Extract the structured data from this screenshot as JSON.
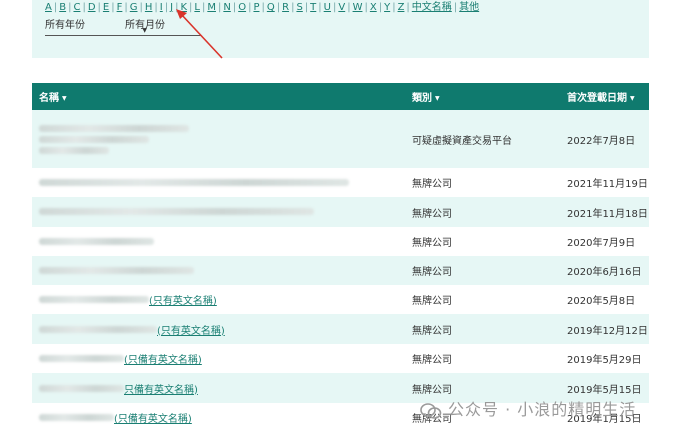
{
  "filters": {
    "letters": [
      "A",
      "B",
      "C",
      "D",
      "E",
      "F",
      "G",
      "H",
      "I",
      "J",
      "K",
      "L",
      "M",
      "N",
      "O",
      "P",
      "Q",
      "R",
      "S",
      "T",
      "U",
      "V",
      "W",
      "X",
      "Y",
      "Z",
      "中文名稱",
      "其他"
    ],
    "year_label": "所有年份",
    "month_label": "所有月份"
  },
  "table": {
    "headers": [
      "名稱",
      "類別",
      "首次登載日期"
    ],
    "rows": [
      {
        "name_suffix": "",
        "category": "可疑虛擬資產交易平台",
        "date": "2022年7月8日"
      },
      {
        "name_suffix": "",
        "category": "無牌公司",
        "date": "2021年11月19日"
      },
      {
        "name_suffix": "",
        "category": "無牌公司",
        "date": "2021年11月18日"
      },
      {
        "name_suffix": "",
        "category": "無牌公司",
        "date": "2020年7月9日"
      },
      {
        "name_suffix": "",
        "category": "無牌公司",
        "date": "2020年6月16日"
      },
      {
        "name_suffix": "(只有英文名稱)",
        "category": "無牌公司",
        "date": "2020年5月8日"
      },
      {
        "name_suffix": "(只有英文名稱)",
        "category": "無牌公司",
        "date": "2019年12月12日"
      },
      {
        "name_suffix": "(只備有英文名稱)",
        "category": "無牌公司",
        "date": "2019年5月29日"
      },
      {
        "name_suffix": "只備有英文名稱)",
        "category": "無牌公司",
        "date": "2019年5月15日"
      },
      {
        "name_suffix": "(只備有英文名稱)",
        "category": "無牌公司",
        "date": "2019年1月15日"
      }
    ]
  },
  "watermark": "公众号 · 小浪的精明生活",
  "colors": {
    "header_bg": "#0f7a6e",
    "row_tint": "#e6f7f5",
    "link": "#1a7f73",
    "arrow": "#d9342b"
  }
}
